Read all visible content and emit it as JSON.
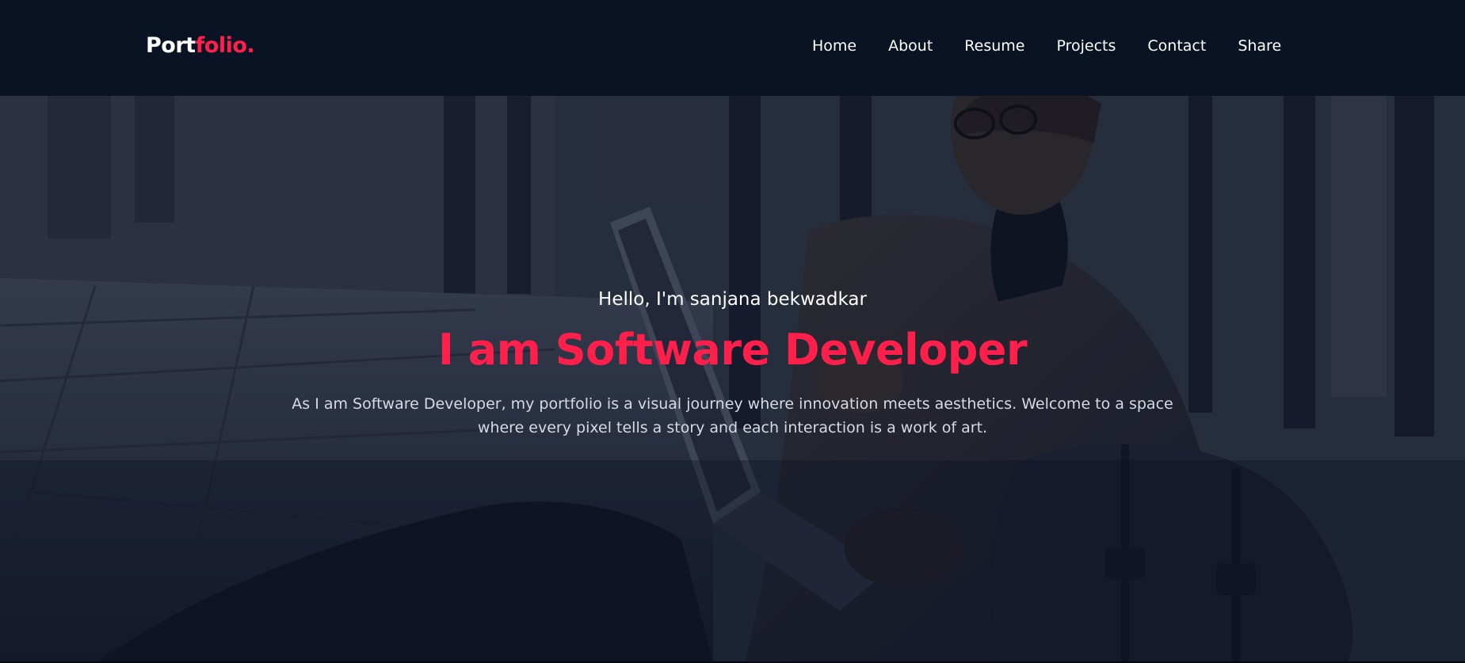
{
  "header": {
    "logo_main": "Port",
    "logo_accent": "folio.",
    "nav": [
      {
        "label": "Home"
      },
      {
        "label": "About"
      },
      {
        "label": "Resume"
      },
      {
        "label": "Projects"
      },
      {
        "label": "Contact"
      },
      {
        "label": "Share"
      }
    ]
  },
  "hero": {
    "greeting": "Hello, I'm sanjana bekwadkar",
    "headline": "I am Software Developer",
    "intro": "As I am Software Developer, my portfolio is a visual journey where innovation meets aesthetics. Welcome to a space where every pixel tells a story and each interaction is a work of art.",
    "background_image": "man-with-laptop-photo"
  },
  "colors": {
    "header_bg": "#0a1324",
    "accent": "#ff1f4b",
    "text_primary": "#ffffff",
    "text_secondary": "#d6dae3"
  }
}
